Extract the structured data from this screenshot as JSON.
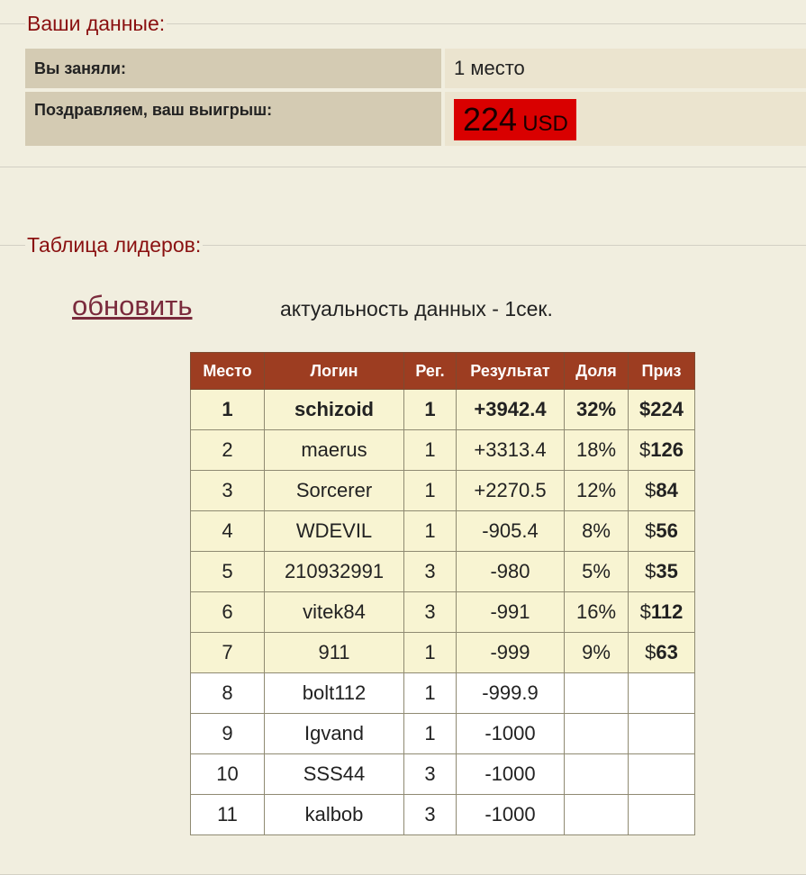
{
  "personal": {
    "legend": "Ваши данные:",
    "place_label": "Вы заняли:",
    "place_value": "1 место",
    "prize_label": "Поздравляем, ваш выигрыш:",
    "prize_amount": "224",
    "prize_currency": "USD"
  },
  "leaderboard": {
    "legend": "Таблица лидеров:",
    "refresh_label": "обновить",
    "freshness_text": "актуальность данных - 1сек.",
    "columns": [
      "Место",
      "Логин",
      "Рег.",
      "Результат",
      "Доля",
      "Приз"
    ],
    "rows": [
      {
        "place": "1",
        "login": "schizoid",
        "reg": "1",
        "result": "+3942.4",
        "share": "32%",
        "prize_sign": "$",
        "prize": "224"
      },
      {
        "place": "2",
        "login": "maerus",
        "reg": "1",
        "result": "+3313.4",
        "share": "18%",
        "prize_sign": "$",
        "prize": "126"
      },
      {
        "place": "3",
        "login": "Sorcerer",
        "reg": "1",
        "result": "+2270.5",
        "share": "12%",
        "prize_sign": "$",
        "prize": "84"
      },
      {
        "place": "4",
        "login": "WDEVIL",
        "reg": "1",
        "result": "-905.4",
        "share": "8%",
        "prize_sign": "$",
        "prize": "56"
      },
      {
        "place": "5",
        "login": "210932991",
        "reg": "3",
        "result": "-980",
        "share": "5%",
        "prize_sign": "$",
        "prize": "35"
      },
      {
        "place": "6",
        "login": "vitek84",
        "reg": "3",
        "result": "-991",
        "share": "16%",
        "prize_sign": "$",
        "prize": "112"
      },
      {
        "place": "7",
        "login": "911",
        "reg": "1",
        "result": "-999",
        "share": "9%",
        "prize_sign": "$",
        "prize": "63"
      },
      {
        "place": "8",
        "login": "bolt112",
        "reg": "1",
        "result": "-999.9",
        "share": "",
        "prize_sign": "",
        "prize": ""
      },
      {
        "place": "9",
        "login": "Igvand",
        "reg": "1",
        "result": "-1000",
        "share": "",
        "prize_sign": "",
        "prize": ""
      },
      {
        "place": "10",
        "login": "SSS44",
        "reg": "3",
        "result": "-1000",
        "share": "",
        "prize_sign": "",
        "prize": ""
      },
      {
        "place": "11",
        "login": "kalbob",
        "reg": "3",
        "result": "-1000",
        "share": "",
        "prize_sign": "",
        "prize": ""
      }
    ]
  },
  "colors": {
    "background": "#f1eedf",
    "legend_text": "#8a1010",
    "label_cell": "#d4cbb3",
    "value_cell": "#ebe4cf",
    "prize_badge": "#d90000",
    "header_bg": "#9d3d21",
    "paid_row_bg": "#f8f4d2",
    "unpaid_row_bg": "#ffffff",
    "link": "#7a2a3c"
  }
}
